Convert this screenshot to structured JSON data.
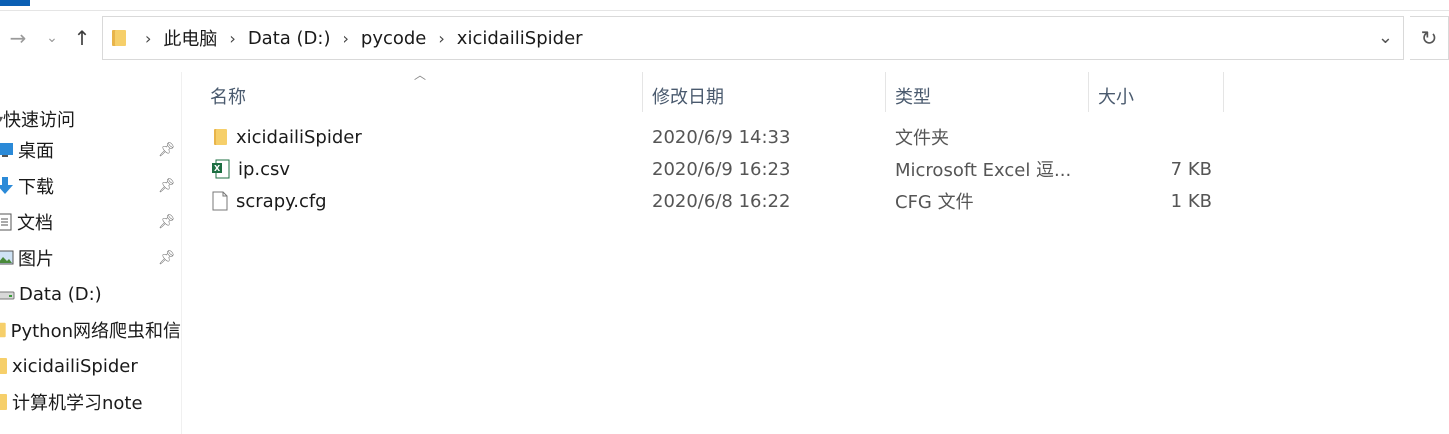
{
  "nav": {
    "breadcrumbs": [
      "此电脑",
      "Data (D:)",
      "pycode",
      "xicidailiSpider"
    ],
    "separator": "›"
  },
  "sidebar": {
    "quick_access_label": "快速访问",
    "items": [
      {
        "label": "桌面",
        "icon": "desktop-icon",
        "pinned": true
      },
      {
        "label": "下载",
        "icon": "download-icon",
        "pinned": true
      },
      {
        "label": "文档",
        "icon": "document-icon",
        "pinned": true
      },
      {
        "label": "图片",
        "icon": "pictures-icon",
        "pinned": true
      },
      {
        "label": "Data (D:)",
        "icon": "drive-icon",
        "pinned": false
      },
      {
        "label": "Python网络爬虫和信",
        "icon": "folder-icon",
        "pinned": false
      },
      {
        "label": "xicidailiSpider",
        "icon": "folder-icon",
        "pinned": false
      },
      {
        "label": "计算机学习note",
        "icon": "folder-icon",
        "pinned": false
      }
    ]
  },
  "columns": {
    "name": "名称",
    "date": "修改日期",
    "type": "类型",
    "size": "大小"
  },
  "files": [
    {
      "name": "xicidailiSpider",
      "date": "2020/6/9 14:33",
      "type": "文件夹",
      "size": "",
      "icon": "folder-icon"
    },
    {
      "name": "ip.csv",
      "date": "2020/6/9 16:23",
      "type": "Microsoft Excel 逗...",
      "size": "7 KB",
      "icon": "excel-icon"
    },
    {
      "name": "scrapy.cfg",
      "date": "2020/6/8 16:22",
      "type": "CFG 文件",
      "size": "1 KB",
      "icon": "file-icon"
    }
  ],
  "colors": {
    "folder": "#f0c15a",
    "accent": "#0b5fb4",
    "excel": "#1d6f42"
  }
}
